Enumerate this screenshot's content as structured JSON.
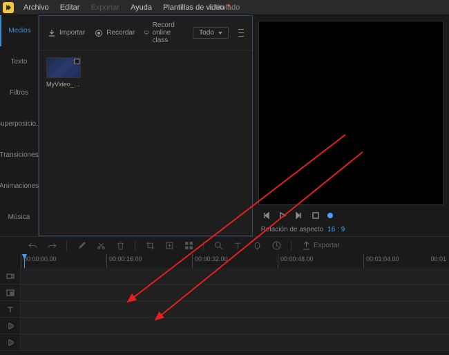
{
  "menubar": {
    "items": [
      {
        "label": "Archivo"
      },
      {
        "label": "Editar"
      },
      {
        "label": "Exportar",
        "disabled": true
      },
      {
        "label": "Ayuda"
      },
      {
        "label": "Plantillas de video",
        "badge": true
      }
    ],
    "title": "Intitulado"
  },
  "left_tabs": [
    {
      "label": "Medios",
      "active": true
    },
    {
      "label": "Texto"
    },
    {
      "label": "Filtros"
    },
    {
      "label": "Superposicio..."
    },
    {
      "label": "Transiciones"
    },
    {
      "label": "Animaciones"
    },
    {
      "label": "Música"
    }
  ],
  "media_toolbar": {
    "import": "Importar",
    "record": "Recordar",
    "record_online": "Record online class",
    "dropdown_selected": "Todo"
  },
  "media_items": [
    {
      "name": "MyVideo_2..."
    }
  ],
  "preview": {
    "aspect_label": "Relación de aspecto",
    "aspect_value": "16 : 9"
  },
  "timeline_toolbar": {
    "export": "Exportar"
  },
  "ruler_marks": [
    "00:00:00.00",
    "00:00:16.00",
    "00:00:32.00",
    "00:00:48.00",
    "00:01:04.00"
  ],
  "ruler_end": "00:01"
}
